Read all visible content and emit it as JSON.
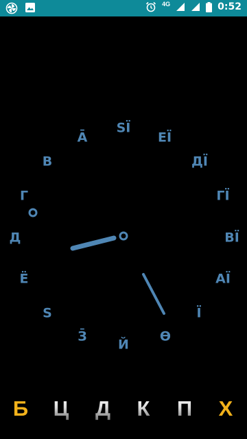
{
  "status_bar": {
    "network_label": "4G",
    "time": "0:52",
    "icons": [
      "pinwheel-icon",
      "image-icon",
      "alarm-icon",
      "signal-icon",
      "signal-icon",
      "battery-icon"
    ],
    "color": "#0e8a99"
  },
  "clock": {
    "hand_color": "#4f86b4",
    "marks": [
      "ЅЇ",
      "ЕЇ",
      "ДЇ",
      "ГЇ",
      "ВЇ",
      "АЇ",
      "Ї",
      "Ѳ",
      "Й",
      "З̄",
      "Ѕ",
      "Ё",
      "Д",
      "Г",
      "В",
      "А̄"
    ]
  },
  "bottom_bar": {
    "letters": [
      {
        "text": "Б",
        "color": "gold"
      },
      {
        "text": "Ц",
        "color": "gray"
      },
      {
        "text": "Д",
        "color": "gray"
      },
      {
        "text": "К",
        "color": "gray"
      },
      {
        "text": "П",
        "color": "gray"
      },
      {
        "text": "Х",
        "color": "gold"
      }
    ]
  }
}
